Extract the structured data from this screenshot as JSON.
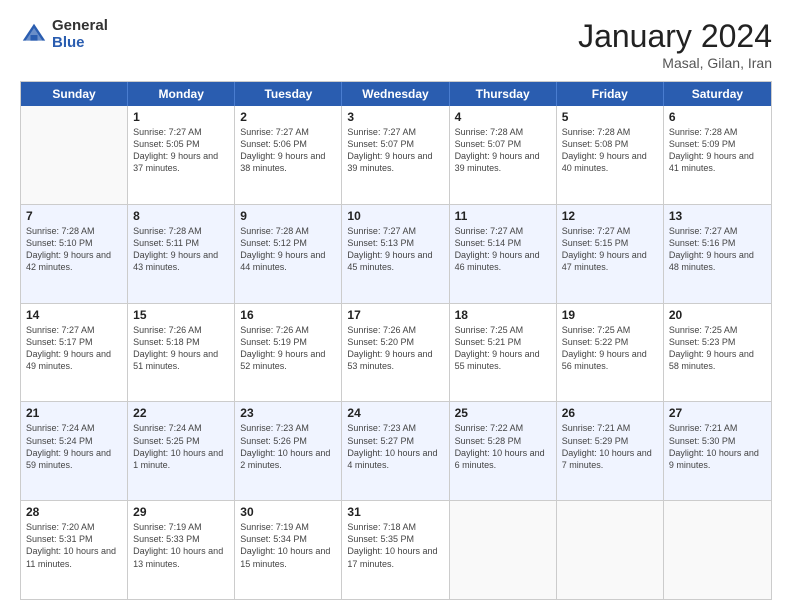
{
  "logo": {
    "general": "General",
    "blue": "Blue"
  },
  "title": "January 2024",
  "subtitle": "Masal, Gilan, Iran",
  "days": [
    "Sunday",
    "Monday",
    "Tuesday",
    "Wednesday",
    "Thursday",
    "Friday",
    "Saturday"
  ],
  "weeks": [
    [
      {
        "day": "",
        "sunrise": "",
        "sunset": "",
        "daylight": ""
      },
      {
        "day": "1",
        "sunrise": "Sunrise: 7:27 AM",
        "sunset": "Sunset: 5:05 PM",
        "daylight": "Daylight: 9 hours and 37 minutes."
      },
      {
        "day": "2",
        "sunrise": "Sunrise: 7:27 AM",
        "sunset": "Sunset: 5:06 PM",
        "daylight": "Daylight: 9 hours and 38 minutes."
      },
      {
        "day": "3",
        "sunrise": "Sunrise: 7:27 AM",
        "sunset": "Sunset: 5:07 PM",
        "daylight": "Daylight: 9 hours and 39 minutes."
      },
      {
        "day": "4",
        "sunrise": "Sunrise: 7:28 AM",
        "sunset": "Sunset: 5:07 PM",
        "daylight": "Daylight: 9 hours and 39 minutes."
      },
      {
        "day": "5",
        "sunrise": "Sunrise: 7:28 AM",
        "sunset": "Sunset: 5:08 PM",
        "daylight": "Daylight: 9 hours and 40 minutes."
      },
      {
        "day": "6",
        "sunrise": "Sunrise: 7:28 AM",
        "sunset": "Sunset: 5:09 PM",
        "daylight": "Daylight: 9 hours and 41 minutes."
      }
    ],
    [
      {
        "day": "7",
        "sunrise": "Sunrise: 7:28 AM",
        "sunset": "Sunset: 5:10 PM",
        "daylight": "Daylight: 9 hours and 42 minutes."
      },
      {
        "day": "8",
        "sunrise": "Sunrise: 7:28 AM",
        "sunset": "Sunset: 5:11 PM",
        "daylight": "Daylight: 9 hours and 43 minutes."
      },
      {
        "day": "9",
        "sunrise": "Sunrise: 7:28 AM",
        "sunset": "Sunset: 5:12 PM",
        "daylight": "Daylight: 9 hours and 44 minutes."
      },
      {
        "day": "10",
        "sunrise": "Sunrise: 7:27 AM",
        "sunset": "Sunset: 5:13 PM",
        "daylight": "Daylight: 9 hours and 45 minutes."
      },
      {
        "day": "11",
        "sunrise": "Sunrise: 7:27 AM",
        "sunset": "Sunset: 5:14 PM",
        "daylight": "Daylight: 9 hours and 46 minutes."
      },
      {
        "day": "12",
        "sunrise": "Sunrise: 7:27 AM",
        "sunset": "Sunset: 5:15 PM",
        "daylight": "Daylight: 9 hours and 47 minutes."
      },
      {
        "day": "13",
        "sunrise": "Sunrise: 7:27 AM",
        "sunset": "Sunset: 5:16 PM",
        "daylight": "Daylight: 9 hours and 48 minutes."
      }
    ],
    [
      {
        "day": "14",
        "sunrise": "Sunrise: 7:27 AM",
        "sunset": "Sunset: 5:17 PM",
        "daylight": "Daylight: 9 hours and 49 minutes."
      },
      {
        "day": "15",
        "sunrise": "Sunrise: 7:26 AM",
        "sunset": "Sunset: 5:18 PM",
        "daylight": "Daylight: 9 hours and 51 minutes."
      },
      {
        "day": "16",
        "sunrise": "Sunrise: 7:26 AM",
        "sunset": "Sunset: 5:19 PM",
        "daylight": "Daylight: 9 hours and 52 minutes."
      },
      {
        "day": "17",
        "sunrise": "Sunrise: 7:26 AM",
        "sunset": "Sunset: 5:20 PM",
        "daylight": "Daylight: 9 hours and 53 minutes."
      },
      {
        "day": "18",
        "sunrise": "Sunrise: 7:25 AM",
        "sunset": "Sunset: 5:21 PM",
        "daylight": "Daylight: 9 hours and 55 minutes."
      },
      {
        "day": "19",
        "sunrise": "Sunrise: 7:25 AM",
        "sunset": "Sunset: 5:22 PM",
        "daylight": "Daylight: 9 hours and 56 minutes."
      },
      {
        "day": "20",
        "sunrise": "Sunrise: 7:25 AM",
        "sunset": "Sunset: 5:23 PM",
        "daylight": "Daylight: 9 hours and 58 minutes."
      }
    ],
    [
      {
        "day": "21",
        "sunrise": "Sunrise: 7:24 AM",
        "sunset": "Sunset: 5:24 PM",
        "daylight": "Daylight: 9 hours and 59 minutes."
      },
      {
        "day": "22",
        "sunrise": "Sunrise: 7:24 AM",
        "sunset": "Sunset: 5:25 PM",
        "daylight": "Daylight: 10 hours and 1 minute."
      },
      {
        "day": "23",
        "sunrise": "Sunrise: 7:23 AM",
        "sunset": "Sunset: 5:26 PM",
        "daylight": "Daylight: 10 hours and 2 minutes."
      },
      {
        "day": "24",
        "sunrise": "Sunrise: 7:23 AM",
        "sunset": "Sunset: 5:27 PM",
        "daylight": "Daylight: 10 hours and 4 minutes."
      },
      {
        "day": "25",
        "sunrise": "Sunrise: 7:22 AM",
        "sunset": "Sunset: 5:28 PM",
        "daylight": "Daylight: 10 hours and 6 minutes."
      },
      {
        "day": "26",
        "sunrise": "Sunrise: 7:21 AM",
        "sunset": "Sunset: 5:29 PM",
        "daylight": "Daylight: 10 hours and 7 minutes."
      },
      {
        "day": "27",
        "sunrise": "Sunrise: 7:21 AM",
        "sunset": "Sunset: 5:30 PM",
        "daylight": "Daylight: 10 hours and 9 minutes."
      }
    ],
    [
      {
        "day": "28",
        "sunrise": "Sunrise: 7:20 AM",
        "sunset": "Sunset: 5:31 PM",
        "daylight": "Daylight: 10 hours and 11 minutes."
      },
      {
        "day": "29",
        "sunrise": "Sunrise: 7:19 AM",
        "sunset": "Sunset: 5:33 PM",
        "daylight": "Daylight: 10 hours and 13 minutes."
      },
      {
        "day": "30",
        "sunrise": "Sunrise: 7:19 AM",
        "sunset": "Sunset: 5:34 PM",
        "daylight": "Daylight: 10 hours and 15 minutes."
      },
      {
        "day": "31",
        "sunrise": "Sunrise: 7:18 AM",
        "sunset": "Sunset: 5:35 PM",
        "daylight": "Daylight: 10 hours and 17 minutes."
      },
      {
        "day": "",
        "sunrise": "",
        "sunset": "",
        "daylight": ""
      },
      {
        "day": "",
        "sunrise": "",
        "sunset": "",
        "daylight": ""
      },
      {
        "day": "",
        "sunrise": "",
        "sunset": "",
        "daylight": ""
      }
    ]
  ]
}
